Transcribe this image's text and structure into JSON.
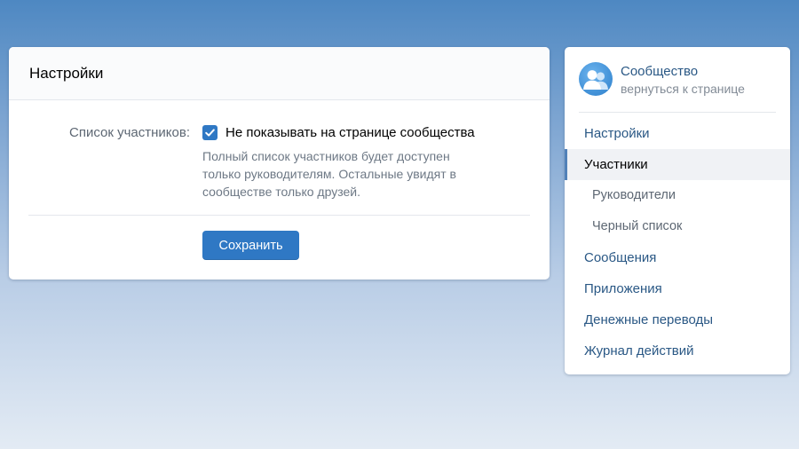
{
  "settings": {
    "title": "Настройки",
    "members_label": "Список участников:",
    "checkbox_checked": true,
    "checkbox_label": "Не показывать на странице сообщества",
    "hint": "Полный список участников будет доступен только руководителям. Остальные увидят в сообществе только друзей.",
    "save_label": "Сохранить"
  },
  "community": {
    "name": "Сообщество",
    "back_link": "вернуться к странице",
    "avatar_icon": "users-icon"
  },
  "nav": {
    "items": [
      {
        "label": "Настройки"
      },
      {
        "label": "Участники",
        "active": true
      },
      {
        "label": "Руководители",
        "sub": true
      },
      {
        "label": "Черный список",
        "sub": true
      },
      {
        "label": "Сообщения"
      },
      {
        "label": "Приложения"
      },
      {
        "label": "Денежные переводы"
      },
      {
        "label": "Журнал действий"
      }
    ]
  },
  "colors": {
    "accent": "#2f78c4",
    "link": "#2a5885",
    "active_marker": "#5181b8"
  }
}
